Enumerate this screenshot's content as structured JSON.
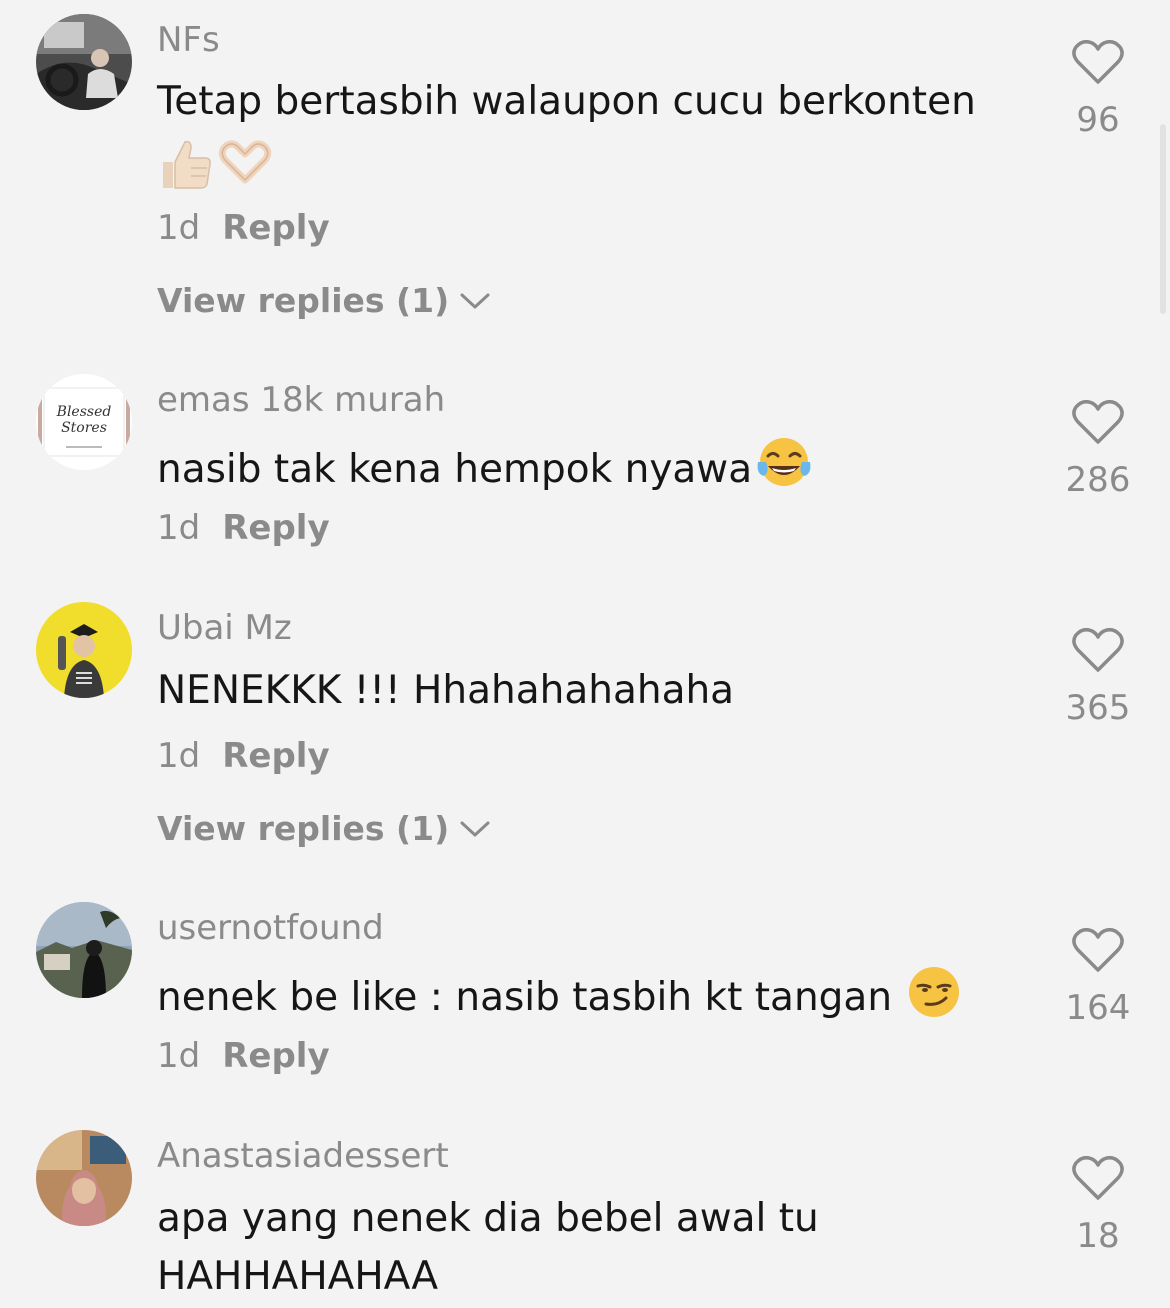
{
  "colors": {
    "background": "#f3f3f3",
    "text": "#161616",
    "muted": "#8a8a8a"
  },
  "comments": [
    {
      "username": "NFs",
      "text": "Tetap bertasbih walaupon cucu berkonten",
      "emojis": [
        "thumbs-up-icon",
        "heart-hands-icon"
      ],
      "time": "1d",
      "reply_label": "Reply",
      "view_replies": "View replies (1)",
      "likes": "96",
      "avatar": "man-driving-avatar"
    },
    {
      "username": "emas 18k murah",
      "text": "nasib tak kena hempok nyawa",
      "emojis": [
        "tears-of-joy-icon"
      ],
      "time": "1d",
      "reply_label": "Reply",
      "likes": "286",
      "avatar": "blessed-stores-logo-avatar",
      "avatar_text": "Blessed Stores"
    },
    {
      "username": "Ubai Mz",
      "text": "NENEKKK !!! Hhahahahahaha",
      "time": "1d",
      "reply_label": "Reply",
      "view_replies": "View replies (1)",
      "likes": "365",
      "avatar": "graduate-yellow-avatar"
    },
    {
      "username": "usernotfound",
      "text": "nenek be like : nasib tasbih kt tangan",
      "emojis": [
        "smirk-icon"
      ],
      "time": "1d",
      "reply_label": "Reply",
      "likes": "164",
      "avatar": "landscape-person-avatar"
    },
    {
      "username": "Anastasiadessert",
      "text": "apa yang nenek dia bebel awal tu HAHHAHAHAA",
      "likes": "18",
      "avatar": "woman-hijab-avatar"
    }
  ]
}
